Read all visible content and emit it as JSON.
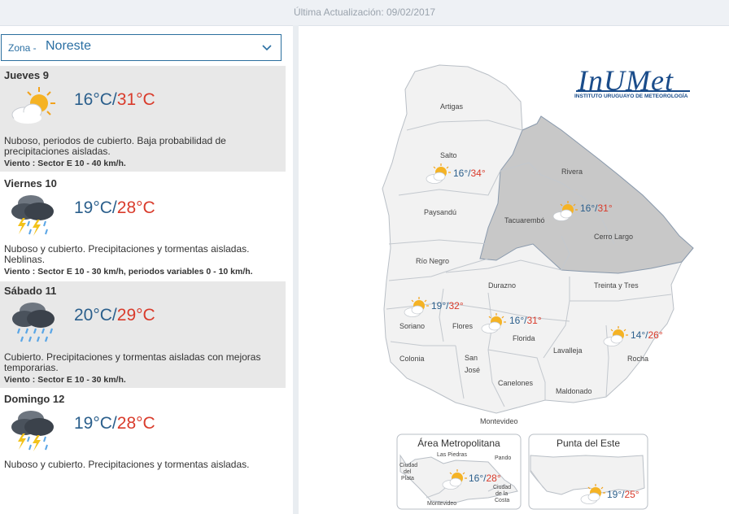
{
  "header": {
    "last_update": "Última Actualización: 09/02/2017"
  },
  "zone_select": {
    "label": "Zona -",
    "value": "Noreste"
  },
  "forecast": [
    {
      "day": "Jueves 9",
      "icon": "partly-cloudy-sun-icon",
      "min": "16°C",
      "sep": "/",
      "max": "31°C",
      "desc": "Nuboso, periodos de cubierto. Baja probabilidad de precipitaciones aisladas.",
      "wind": "Viento : Sector E 10 - 40 km/h."
    },
    {
      "day": "Viernes 10",
      "icon": "thunderstorm-icon",
      "min": "19°C",
      "sep": "/",
      "max": "28°C",
      "desc": "Nuboso y cubierto. Precipitaciones y tormentas aisladas. Neblinas.",
      "wind": "Viento : Sector E 10 - 30 km/h, periodos variables 0 - 10 km/h."
    },
    {
      "day": "Sábado 11",
      "icon": "rain-icon",
      "min": "20°C",
      "sep": "/",
      "max": "29°C",
      "desc": "Cubierto. Precipitaciones y tormentas aisladas con mejoras temporarias.",
      "wind": "Viento : Sector E 10 - 30 km/h."
    },
    {
      "day": "Domingo 12",
      "icon": "thunderstorm-icon",
      "min": "19°C",
      "sep": "/",
      "max": "28°C",
      "desc": "Nuboso y cubierto. Precipitaciones y tormentas aisladas.",
      "wind": ""
    }
  ],
  "logo": {
    "name": "InUMet",
    "subtitle": "INSTITUTO URUGUAYO DE METEOROLOGÍA"
  },
  "map": {
    "departments": {
      "artigas": "Artigas",
      "salto": "Salto",
      "paysandu": "Paysandú",
      "rio_negro": "Río Negro",
      "soriano": "Soriano",
      "colonia": "Colonia",
      "flores": "Flores",
      "san_jose_1": "San",
      "san_jose_2": "José",
      "durazno": "Durazno",
      "florida": "Florida",
      "canelones": "Canelones",
      "montevideo": "Montevideo",
      "lavalleja": "Lavalleja",
      "maldonado": "Maldonado",
      "rocha": "Rocha",
      "treinta_y_tres": "Treinta y Tres",
      "cerro_largo": "Cerro Largo",
      "rivera": "Rivera",
      "tacuarembo": "Tacuarembó"
    },
    "zone_temps": {
      "litoral_norte": {
        "min": "16°",
        "sep": "/",
        "max": "34°"
      },
      "noreste": {
        "min": "16°",
        "sep": "/",
        "max": "31°"
      },
      "suroeste": {
        "min": "19°",
        "sep": "/",
        "max": "32°"
      },
      "centro_sur": {
        "min": "16°",
        "sep": "/",
        "max": "31°"
      },
      "sureste": {
        "min": "14°",
        "sep": "/",
        "max": "26°"
      }
    },
    "inset_metro": {
      "title": "Área Metropolitana",
      "labels": {
        "las_piedras": "Las Piedras",
        "pando": "Pando",
        "ciudad_plata_1": "Ciudad",
        "ciudad_plata_2": "del",
        "ciudad_plata_3": "Plata",
        "ciudad_costa_1": "Ciudad",
        "ciudad_costa_2": "de la",
        "ciudad_costa_3": "Costa",
        "montevideo": "Montevideo"
      },
      "min": "16°",
      "sep": "/",
      "max": "28°"
    },
    "inset_este": {
      "title": "Punta del Este",
      "min": "19°",
      "sep": "/",
      "max": "25°"
    }
  },
  "colors": {
    "min_temp": "#2b5f8c",
    "max_temp": "#d93b2b",
    "selected_zone": "#c8c8c8",
    "map_fill": "#f2f2f2"
  }
}
